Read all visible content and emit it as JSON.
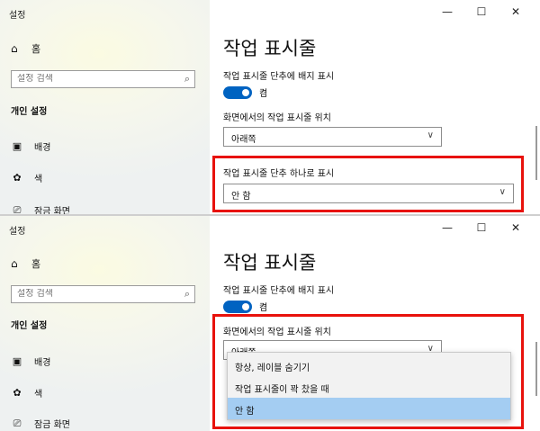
{
  "app": {
    "title": "설정",
    "home": "홈",
    "search_placeholder": "설정 검색",
    "section": "개인 설정",
    "nav": {
      "background": "배경",
      "color": "색",
      "lockscreen": "잠금 화면"
    }
  },
  "window_controls": {
    "minimize": "—",
    "maximize": "☐",
    "close": "✕"
  },
  "page": {
    "title": "작업 표시줄",
    "badge_label": "작업 표시줄 단추에 배지 표시",
    "badge_state": "켬",
    "position_label": "화면에서의 작업 표시줄 위치",
    "position_value": "아래쪽",
    "combine_label": "작업 표시줄 단추 하나로 표시",
    "combine_value": "안 함"
  },
  "dropdown": {
    "options": [
      "항상, 레이블 숨기기",
      "작업 표시줄이 꽉 찼을 때",
      "안 함"
    ],
    "selected_index": 2
  },
  "colors": {
    "accent": "#0063c1",
    "highlight": "#e8120c",
    "selected": "#a4cdf2"
  }
}
